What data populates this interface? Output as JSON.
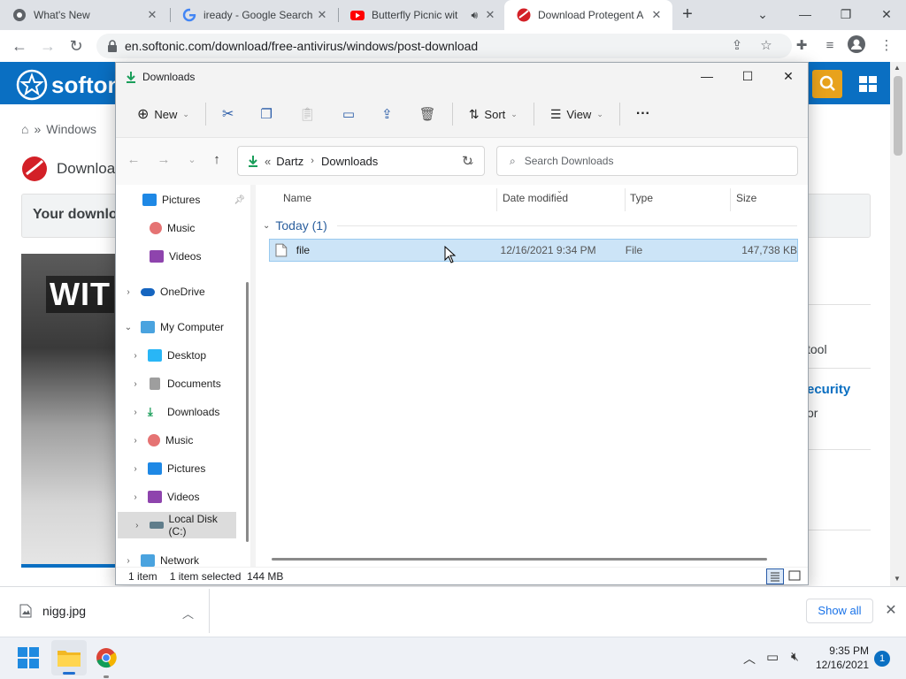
{
  "browser": {
    "tabs": [
      {
        "title": "What's New",
        "icon": "chrome-icon"
      },
      {
        "title": "iready - Google Search",
        "icon": "google-icon"
      },
      {
        "title": "Butterfly Picnic wit",
        "icon": "youtube-icon",
        "audio": true
      },
      {
        "title": "Download Protegent A",
        "icon": "softonic-icon",
        "active": true
      }
    ],
    "url": "en.softonic.com/download/free-antivirus/windows/post-download"
  },
  "page": {
    "logo_text": "softoni",
    "breadcrumb": [
      "Windows"
    ],
    "download_heading": "Downloa",
    "your_download": "Your downlo",
    "hero_text": "WIT",
    "right_snippets": [
      "tool",
      "ecurity",
      "or"
    ]
  },
  "explorer": {
    "title": "Downloads",
    "commands": {
      "new": "New",
      "sort": "Sort",
      "view": "View",
      "more": "···"
    },
    "address": {
      "overflow": "«",
      "parts": [
        "Dartz",
        "Downloads"
      ]
    },
    "search_placeholder": "Search Downloads",
    "nav": [
      {
        "label": "Pictures",
        "icon": "pictures-icon",
        "pinned": true
      },
      {
        "label": "Music",
        "icon": "music-icon"
      },
      {
        "label": "Videos",
        "icon": "videos-icon"
      },
      {
        "label": "OneDrive",
        "icon": "onedrive-icon"
      },
      {
        "label": "My Computer",
        "icon": "computer-icon"
      },
      {
        "label": "Desktop",
        "icon": "desktop-icon"
      },
      {
        "label": "Documents",
        "icon": "documents-icon"
      },
      {
        "label": "Downloads",
        "icon": "downloads-icon"
      },
      {
        "label": "Music",
        "icon": "music-icon"
      },
      {
        "label": "Pictures",
        "icon": "pictures-icon"
      },
      {
        "label": "Videos",
        "icon": "videos-icon"
      },
      {
        "label": "Local Disk (C:)",
        "icon": "disk-icon"
      },
      {
        "label": "Network",
        "icon": "network-icon"
      }
    ],
    "columns": [
      "Name",
      "Date modified",
      "Type",
      "Size"
    ],
    "group": "Today (1)",
    "files": [
      {
        "name": "file",
        "date": "12/16/2021 9:34 PM",
        "type": "File",
        "size": "147,738 KB"
      }
    ],
    "status": {
      "count": "1 item",
      "selected": "1 item selected  144 MB"
    }
  },
  "shelf": {
    "filename": "nigg.jpg",
    "show_all": "Show all"
  },
  "taskbar": {
    "time": "9:35 PM",
    "date": "12/16/2021",
    "notifications": "1"
  },
  "colors": {
    "softonic_blue": "#0a6fc2",
    "search_orange": "#e8a21c",
    "selection": "#cce4f7"
  }
}
